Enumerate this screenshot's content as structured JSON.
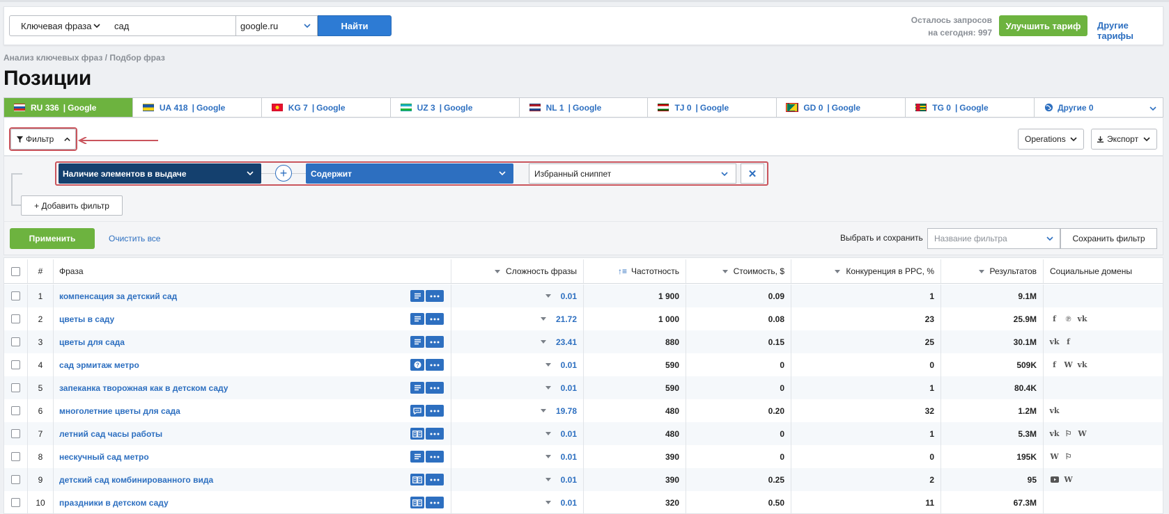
{
  "search": {
    "type_label": "Ключевая фраза",
    "query_value": "сад",
    "engine_value": "google.ru",
    "find_button": "Найти",
    "remaining_line1": "Осталось запросов",
    "remaining_line2": "на сегодня: 997",
    "upgrade_button": "Улучшить тариф",
    "other_tariffs_link": "Другие тарифы"
  },
  "breadcrumb": "Анализ ключевых фраз / Подбор фраз",
  "page_title": "Позиции",
  "tabs": [
    {
      "code": "RU",
      "count": "336",
      "engine": "Google",
      "active": true,
      "flag": "ru"
    },
    {
      "code": "UA",
      "count": "418",
      "engine": "Google",
      "active": false,
      "flag": "ua"
    },
    {
      "code": "KG",
      "count": "7",
      "engine": "Google",
      "active": false,
      "flag": "kg"
    },
    {
      "code": "UZ",
      "count": "3",
      "engine": "Google",
      "active": false,
      "flag": "uz"
    },
    {
      "code": "NL",
      "count": "1",
      "engine": "Google",
      "active": false,
      "flag": "nl"
    },
    {
      "code": "TJ",
      "count": "0",
      "engine": "Google",
      "active": false,
      "flag": "tj"
    },
    {
      "code": "GD",
      "count": "0",
      "engine": "Google",
      "active": false,
      "flag": "gd"
    },
    {
      "code": "TG",
      "count": "0",
      "engine": "Google",
      "active": false,
      "flag": "tg"
    }
  ],
  "other_tab_label": "Другие 0",
  "toolbar": {
    "filter_label": "Фильтр",
    "operations_label": "Operations",
    "export_label": "Экспорт"
  },
  "filter": {
    "field": "Наличие элементов в выдаче",
    "operator": "Содержит",
    "value": "Избранный сниппет",
    "add_filter": "+ Добавить фильтр",
    "apply": "Применить",
    "clear_all": "Очистить все",
    "save_label": "Выбрать и сохранить",
    "filter_name_placeholder": "Название фильтра",
    "save_filter": "Сохранить фильтр"
  },
  "table": {
    "headers": {
      "num": "#",
      "phrase": "Фраза",
      "difficulty": "Сложность фразы",
      "frequency": "Частотность",
      "cost": "Стоимость, $",
      "competition": "Конкуренция в PPC, %",
      "results": "Результатов",
      "social": "Социальные домены"
    },
    "rows": [
      {
        "n": "1",
        "phrase": "компенсация за детский сад",
        "diff": "0.01",
        "freq": "1 900",
        "cost": "0.09",
        "comp": "1",
        "res": "9.1M",
        "social": [],
        "icon": "list"
      },
      {
        "n": "2",
        "phrase": "цветы в саду",
        "diff": "21.72",
        "freq": "1 000",
        "cost": "0.08",
        "comp": "23",
        "res": "25.9M",
        "social": [
          "f",
          "p",
          "vk"
        ],
        "icon": "list"
      },
      {
        "n": "3",
        "phrase": "цветы для сада",
        "diff": "23.41",
        "freq": "880",
        "cost": "0.15",
        "comp": "25",
        "res": "30.1M",
        "social": [
          "vk",
          "f"
        ],
        "icon": "list"
      },
      {
        "n": "4",
        "phrase": "сад эрмитаж метро",
        "diff": "0.01",
        "freq": "590",
        "cost": "0",
        "comp": "0",
        "res": "509K",
        "social": [
          "f",
          "W",
          "vk"
        ],
        "icon": "question"
      },
      {
        "n": "5",
        "phrase": "запеканка творожная как в детском саду",
        "diff": "0.01",
        "freq": "590",
        "cost": "0",
        "comp": "1",
        "res": "80.4K",
        "social": [],
        "icon": "list"
      },
      {
        "n": "6",
        "phrase": "многолетние цветы для сада",
        "diff": "19.78",
        "freq": "480",
        "cost": "0.20",
        "comp": "32",
        "res": "1.2M",
        "social": [
          "vk"
        ],
        "icon": "chat"
      },
      {
        "n": "7",
        "phrase": "летний сад часы работы",
        "diff": "0.01",
        "freq": "480",
        "cost": "0",
        "comp": "1",
        "res": "5.3M",
        "social": [
          "vk",
          "fs",
          "W"
        ],
        "icon": "card"
      },
      {
        "n": "8",
        "phrase": "нескучный сад метро",
        "diff": "0.01",
        "freq": "390",
        "cost": "0",
        "comp": "0",
        "res": "195K",
        "social": [
          "W",
          "fs"
        ],
        "icon": "list"
      },
      {
        "n": "9",
        "phrase": "детский сад комбинированного вида",
        "diff": "0.01",
        "freq": "390",
        "cost": "0.25",
        "comp": "2",
        "res": "95",
        "social": [
          "yt",
          "W"
        ],
        "icon": "card"
      },
      {
        "n": "10",
        "phrase": "праздники в детском саду",
        "diff": "0.01",
        "freq": "320",
        "cost": "0.50",
        "comp": "11",
        "res": "67.3M",
        "social": [],
        "icon": "card"
      }
    ]
  },
  "colors": {
    "accent": "#2d6fc0",
    "green": "#6db33f",
    "highlight": "#c9545c",
    "dark_blue": "#14406e"
  }
}
